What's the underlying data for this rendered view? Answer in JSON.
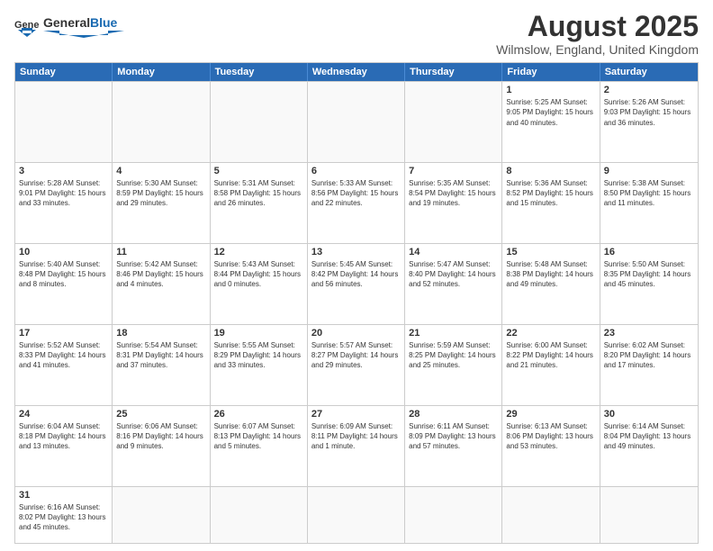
{
  "header": {
    "logo_general": "General",
    "logo_blue": "Blue",
    "title": "August 2025",
    "subtitle": "Wilmslow, England, United Kingdom"
  },
  "days": [
    "Sunday",
    "Monday",
    "Tuesday",
    "Wednesday",
    "Thursday",
    "Friday",
    "Saturday"
  ],
  "weeks": [
    [
      {
        "day": "",
        "info": ""
      },
      {
        "day": "",
        "info": ""
      },
      {
        "day": "",
        "info": ""
      },
      {
        "day": "",
        "info": ""
      },
      {
        "day": "",
        "info": ""
      },
      {
        "day": "1",
        "info": "Sunrise: 5:25 AM\nSunset: 9:05 PM\nDaylight: 15 hours and 40 minutes."
      },
      {
        "day": "2",
        "info": "Sunrise: 5:26 AM\nSunset: 9:03 PM\nDaylight: 15 hours and 36 minutes."
      }
    ],
    [
      {
        "day": "3",
        "info": "Sunrise: 5:28 AM\nSunset: 9:01 PM\nDaylight: 15 hours and 33 minutes."
      },
      {
        "day": "4",
        "info": "Sunrise: 5:30 AM\nSunset: 8:59 PM\nDaylight: 15 hours and 29 minutes."
      },
      {
        "day": "5",
        "info": "Sunrise: 5:31 AM\nSunset: 8:58 PM\nDaylight: 15 hours and 26 minutes."
      },
      {
        "day": "6",
        "info": "Sunrise: 5:33 AM\nSunset: 8:56 PM\nDaylight: 15 hours and 22 minutes."
      },
      {
        "day": "7",
        "info": "Sunrise: 5:35 AM\nSunset: 8:54 PM\nDaylight: 15 hours and 19 minutes."
      },
      {
        "day": "8",
        "info": "Sunrise: 5:36 AM\nSunset: 8:52 PM\nDaylight: 15 hours and 15 minutes."
      },
      {
        "day": "9",
        "info": "Sunrise: 5:38 AM\nSunset: 8:50 PM\nDaylight: 15 hours and 11 minutes."
      }
    ],
    [
      {
        "day": "10",
        "info": "Sunrise: 5:40 AM\nSunset: 8:48 PM\nDaylight: 15 hours and 8 minutes."
      },
      {
        "day": "11",
        "info": "Sunrise: 5:42 AM\nSunset: 8:46 PM\nDaylight: 15 hours and 4 minutes."
      },
      {
        "day": "12",
        "info": "Sunrise: 5:43 AM\nSunset: 8:44 PM\nDaylight: 15 hours and 0 minutes."
      },
      {
        "day": "13",
        "info": "Sunrise: 5:45 AM\nSunset: 8:42 PM\nDaylight: 14 hours and 56 minutes."
      },
      {
        "day": "14",
        "info": "Sunrise: 5:47 AM\nSunset: 8:40 PM\nDaylight: 14 hours and 52 minutes."
      },
      {
        "day": "15",
        "info": "Sunrise: 5:48 AM\nSunset: 8:38 PM\nDaylight: 14 hours and 49 minutes."
      },
      {
        "day": "16",
        "info": "Sunrise: 5:50 AM\nSunset: 8:35 PM\nDaylight: 14 hours and 45 minutes."
      }
    ],
    [
      {
        "day": "17",
        "info": "Sunrise: 5:52 AM\nSunset: 8:33 PM\nDaylight: 14 hours and 41 minutes."
      },
      {
        "day": "18",
        "info": "Sunrise: 5:54 AM\nSunset: 8:31 PM\nDaylight: 14 hours and 37 minutes."
      },
      {
        "day": "19",
        "info": "Sunrise: 5:55 AM\nSunset: 8:29 PM\nDaylight: 14 hours and 33 minutes."
      },
      {
        "day": "20",
        "info": "Sunrise: 5:57 AM\nSunset: 8:27 PM\nDaylight: 14 hours and 29 minutes."
      },
      {
        "day": "21",
        "info": "Sunrise: 5:59 AM\nSunset: 8:25 PM\nDaylight: 14 hours and 25 minutes."
      },
      {
        "day": "22",
        "info": "Sunrise: 6:00 AM\nSunset: 8:22 PM\nDaylight: 14 hours and 21 minutes."
      },
      {
        "day": "23",
        "info": "Sunrise: 6:02 AM\nSunset: 8:20 PM\nDaylight: 14 hours and 17 minutes."
      }
    ],
    [
      {
        "day": "24",
        "info": "Sunrise: 6:04 AM\nSunset: 8:18 PM\nDaylight: 14 hours and 13 minutes."
      },
      {
        "day": "25",
        "info": "Sunrise: 6:06 AM\nSunset: 8:16 PM\nDaylight: 14 hours and 9 minutes."
      },
      {
        "day": "26",
        "info": "Sunrise: 6:07 AM\nSunset: 8:13 PM\nDaylight: 14 hours and 5 minutes."
      },
      {
        "day": "27",
        "info": "Sunrise: 6:09 AM\nSunset: 8:11 PM\nDaylight: 14 hours and 1 minute."
      },
      {
        "day": "28",
        "info": "Sunrise: 6:11 AM\nSunset: 8:09 PM\nDaylight: 13 hours and 57 minutes."
      },
      {
        "day": "29",
        "info": "Sunrise: 6:13 AM\nSunset: 8:06 PM\nDaylight: 13 hours and 53 minutes."
      },
      {
        "day": "30",
        "info": "Sunrise: 6:14 AM\nSunset: 8:04 PM\nDaylight: 13 hours and 49 minutes."
      }
    ],
    [
      {
        "day": "31",
        "info": "Sunrise: 6:16 AM\nSunset: 8:02 PM\nDaylight: 13 hours and 45 minutes."
      },
      {
        "day": "",
        "info": ""
      },
      {
        "day": "",
        "info": ""
      },
      {
        "day": "",
        "info": ""
      },
      {
        "day": "",
        "info": ""
      },
      {
        "day": "",
        "info": ""
      },
      {
        "day": "",
        "info": ""
      }
    ]
  ]
}
